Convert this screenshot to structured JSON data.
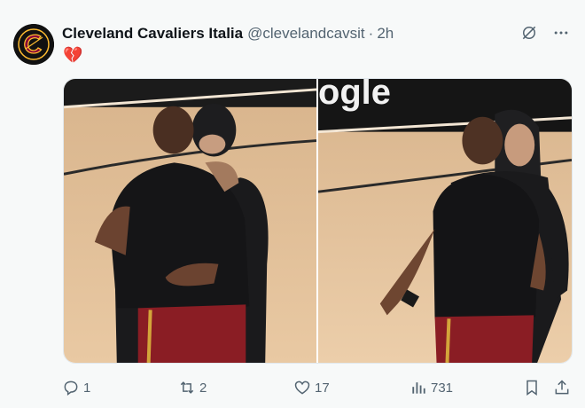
{
  "author": {
    "name": "Cleveland Cavaliers Italia",
    "handle": "@clevelandcavsit",
    "separator": "·",
    "time": "2h"
  },
  "avatar_icon": "cavaliers-c-logo",
  "tweet": {
    "text": "💔"
  },
  "media": {
    "photo_count": 2,
    "court_sign_text": "ogle"
  },
  "actions": {
    "reply_count": "1",
    "retweet_count": "2",
    "like_count": "17",
    "view_count": "731"
  },
  "colors": {
    "accent": "#1d9bf0",
    "muted": "#536471",
    "cavs_wine": "#860038",
    "cavs_gold": "#fdbb30"
  }
}
